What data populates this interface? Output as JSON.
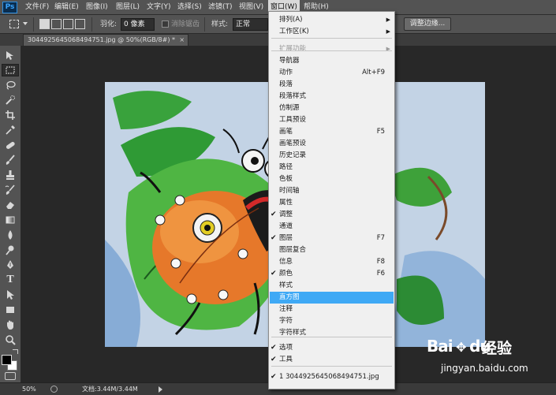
{
  "app": {
    "logo": "Ps"
  },
  "menubar": {
    "items": [
      "文件(F)",
      "编辑(E)",
      "图像(I)",
      "图层(L)",
      "文字(Y)",
      "选择(S)",
      "滤镜(T)",
      "视图(V)",
      "窗口(W)",
      "帮助(H)"
    ],
    "active_index": 8
  },
  "options": {
    "feather_label": "羽化:",
    "feather_value": "0 像素",
    "antialias_label": "消除锯齿",
    "style_label": "样式:",
    "style_value": "正常",
    "refine_edge_label": "调整边缘..."
  },
  "document": {
    "tab_title": "3044925645068494751.jpg @ 50%(RGB/8#) *",
    "close_glyph": "×"
  },
  "status": {
    "zoom": "50%",
    "doc_info": "文档:3.44M/3.44M"
  },
  "window_menu": {
    "items": [
      {
        "label": "排列(A)",
        "submenu": true
      },
      {
        "label": "工作区(K)",
        "submenu": true
      },
      {
        "label": "扩展功能",
        "submenu": true,
        "disabled": true
      },
      {
        "label": "导航器"
      },
      {
        "label": "动作",
        "shortcut": "Alt+F9"
      },
      {
        "label": "段落"
      },
      {
        "label": "段落样式"
      },
      {
        "label": "仿制源"
      },
      {
        "label": "工具预设"
      },
      {
        "label": "画笔",
        "shortcut": "F5"
      },
      {
        "label": "画笔预设"
      },
      {
        "label": "历史记录"
      },
      {
        "label": "路径"
      },
      {
        "label": "色板"
      },
      {
        "label": "时间轴"
      },
      {
        "label": "属性"
      },
      {
        "label": "调整",
        "checked": true
      },
      {
        "label": "通道"
      },
      {
        "label": "图层",
        "shortcut": "F7",
        "checked": true
      },
      {
        "label": "图层复合"
      },
      {
        "label": "信息",
        "shortcut": "F8"
      },
      {
        "label": "颜色",
        "shortcut": "F6",
        "checked": true
      },
      {
        "label": "样式"
      },
      {
        "label": "直方图",
        "highlighted": true
      },
      {
        "label": "注释"
      },
      {
        "label": "字符"
      },
      {
        "label": "字符样式"
      },
      {
        "label": "选项",
        "checked": true
      },
      {
        "label": "工具",
        "checked": true
      },
      {
        "label": "1 3044925645068494751.jpg",
        "checked": true
      }
    ],
    "check_glyph": "✔",
    "arrow_glyph": "▶"
  },
  "toolbar": {
    "tools": [
      "move-tool",
      "marquee-tool",
      "lasso-tool",
      "quick-selection-tool",
      "crop-tool",
      "eyedropper-tool",
      "healing-brush-tool",
      "brush-tool",
      "clone-stamp-tool",
      "history-brush-tool",
      "eraser-tool",
      "gradient-tool",
      "blur-tool",
      "dodge-tool",
      "pen-tool",
      "type-tool",
      "path-selection-tool",
      "rectangle-tool",
      "hand-tool",
      "zoom-tool"
    ],
    "type_glyph": "T"
  },
  "watermark": {
    "brand": "Bai",
    "brand_suffix": "du",
    "cn": "经验",
    "url": "jingyan.baidu.com"
  },
  "colors": {
    "menu_highlight": "#3fa9f5",
    "ui_dark": "#535353",
    "canvas_bg": "#282828"
  }
}
